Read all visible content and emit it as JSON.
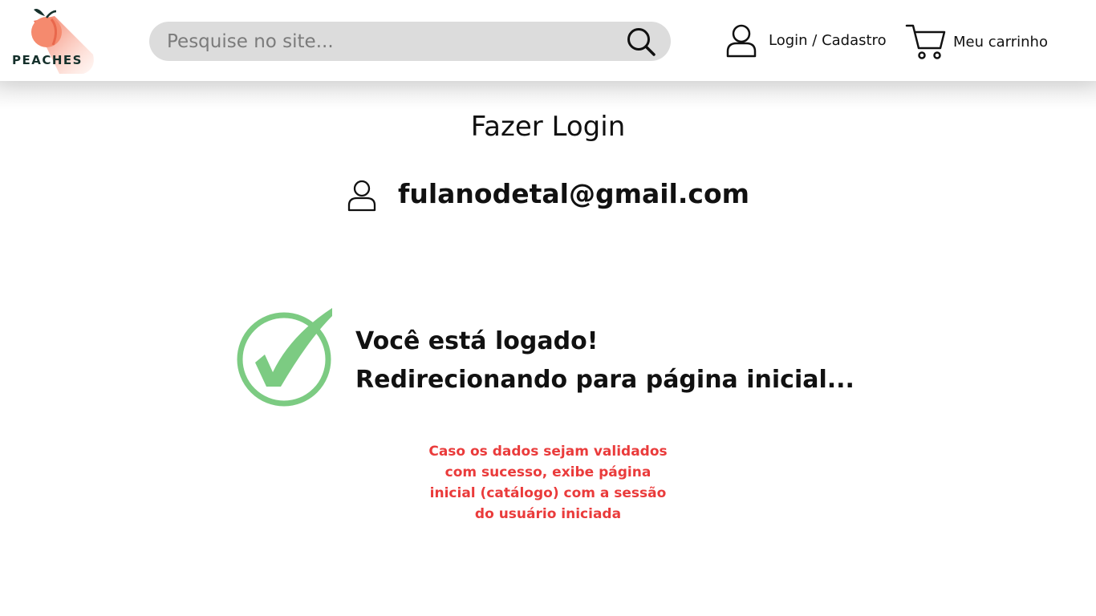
{
  "header": {
    "logo_text": "PEACHES",
    "search": {
      "placeholder": "Pesquise no site...",
      "icon": "search-icon"
    },
    "account": {
      "label": "Login / Cadastro",
      "icon": "user-icon"
    },
    "cart": {
      "label": "Meu carrinho",
      "icon": "cart-icon"
    }
  },
  "main": {
    "title": "Fazer Login",
    "user": {
      "email": "fulanodetal@gmail.com",
      "icon": "user-icon"
    },
    "success": {
      "icon": "check-circle-icon",
      "line1": "Você está logado!",
      "line2": "Redirecionando para página inicial..."
    },
    "annotation": {
      "lines": [
        "Caso os dados sejam validados",
        "com sucesso, exibe página",
        "inicial (catálogo) com a sessão",
        "do usuário iniciada"
      ]
    }
  },
  "colors": {
    "accent_peach": "#f27a5e",
    "success_green": "#7ccb82",
    "annotation_red": "#ea3b3b",
    "search_bg": "#dcdcdc"
  }
}
